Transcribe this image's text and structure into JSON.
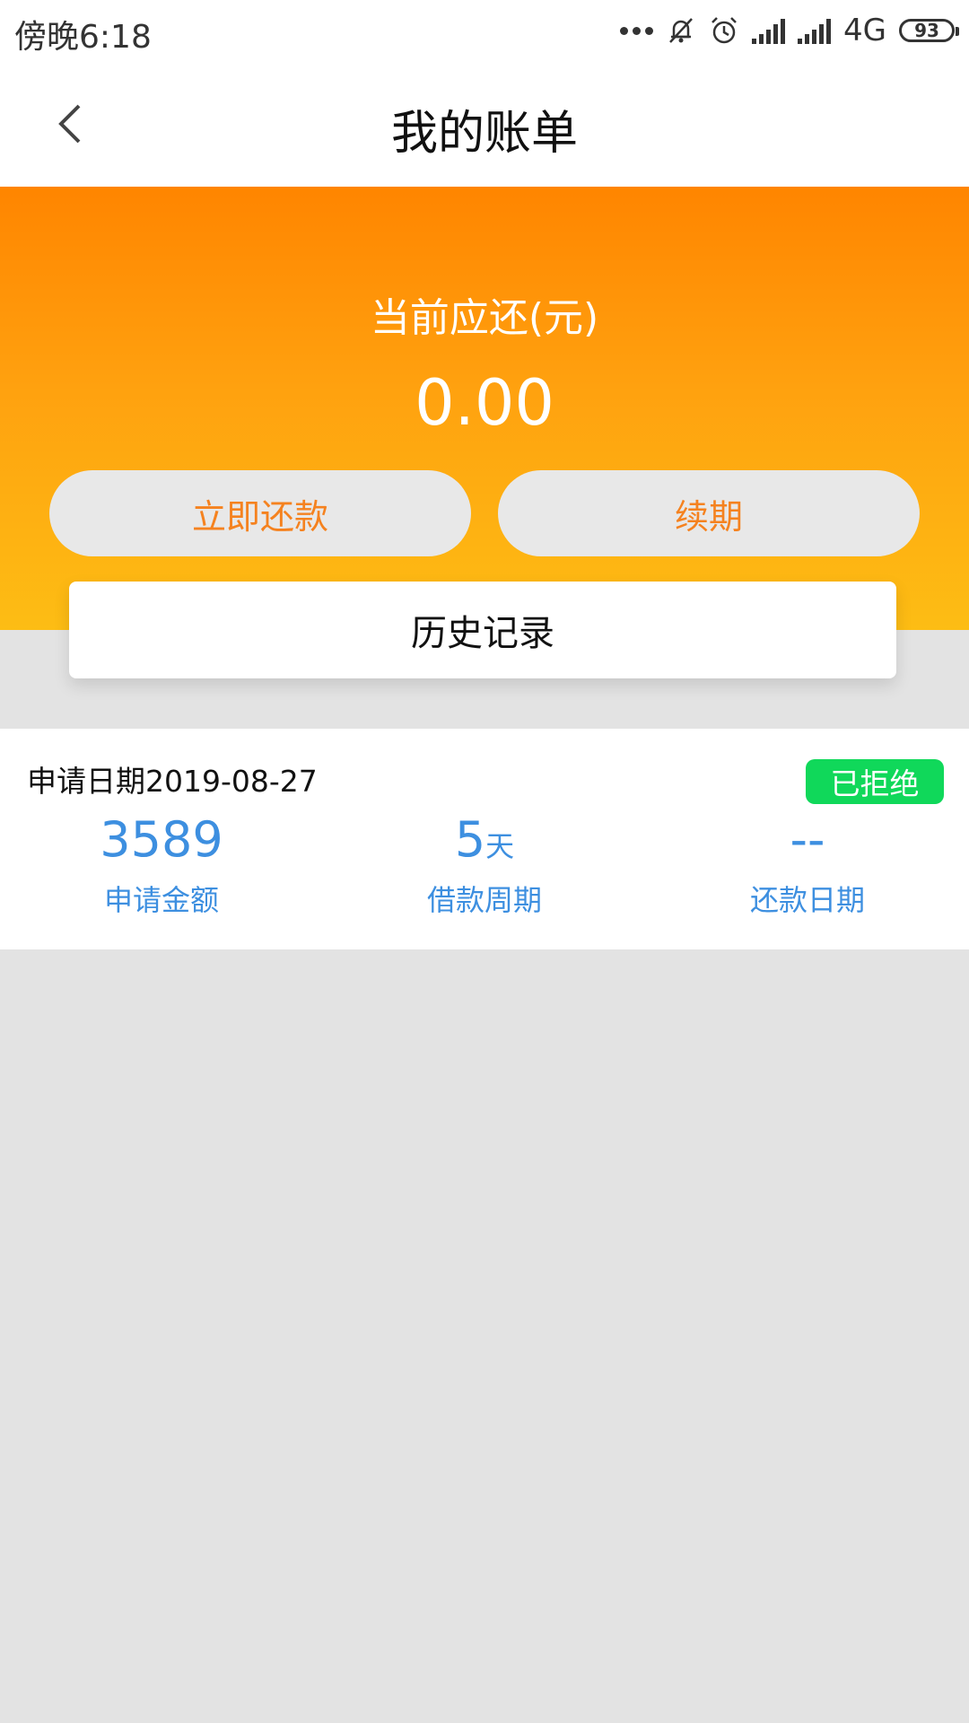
{
  "status_bar": {
    "time": "傍晚6:18",
    "network": "4G",
    "battery": "93"
  },
  "header": {
    "title": "我的账单"
  },
  "summary": {
    "label": "当前应还(元)",
    "amount": "0.00",
    "repay_button": "立即还款",
    "renew_button": "续期",
    "history_button": "历史记录"
  },
  "record": {
    "date_text": "申请日期2019-08-27",
    "status": "已拒绝",
    "amount_value": "3589",
    "amount_label": "申请金额",
    "period_value": "5",
    "period_unit": "天",
    "period_label": "借款周期",
    "repay_date_value": "--",
    "repay_date_label": "还款日期"
  },
  "colors": {
    "accent_orange": "#f5821f",
    "metric_blue": "#3d8fe0",
    "badge_green": "#10d85a"
  }
}
